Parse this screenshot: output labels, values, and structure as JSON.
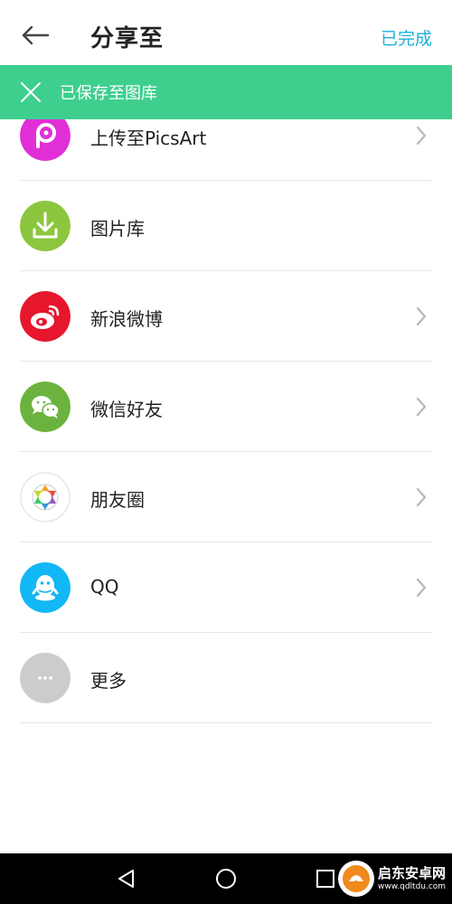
{
  "header": {
    "title": "分享至",
    "done_label": "已完成",
    "back_icon": "arrow-left-icon"
  },
  "toast": {
    "text": "已保存至图库",
    "close_icon": "close-icon"
  },
  "share_targets": [
    {
      "label": "上传至PicsArt",
      "icon": "picsart-icon",
      "has_chevron": true
    },
    {
      "label": "图片库",
      "icon": "download-icon",
      "has_chevron": false
    },
    {
      "label": "新浪微博",
      "icon": "weibo-icon",
      "has_chevron": true
    },
    {
      "label": "微信好友",
      "icon": "wechat-icon",
      "has_chevron": true
    },
    {
      "label": "朋友圈",
      "icon": "moments-icon",
      "has_chevron": true
    },
    {
      "label": "QQ",
      "icon": "qq-icon",
      "has_chevron": true
    },
    {
      "label": "更多",
      "icon": "more-icon",
      "has_chevron": false
    }
  ],
  "navbar": {
    "back_icon": "nav-back-icon",
    "home_icon": "nav-home-icon",
    "recents_icon": "nav-recents-icon"
  },
  "watermark": {
    "title": "启东安卓网",
    "url": "www.qdltdu.com"
  },
  "colors": {
    "accent": "#1bb0d8",
    "toast_bg": "#3ecf8e",
    "picsart": "#e02fd6",
    "download": "#8cc63f",
    "weibo": "#e6162d",
    "wechat": "#6bb33e",
    "qq": "#12b7f5",
    "more": "#cccccc",
    "chevron": "#b8b8b8"
  }
}
